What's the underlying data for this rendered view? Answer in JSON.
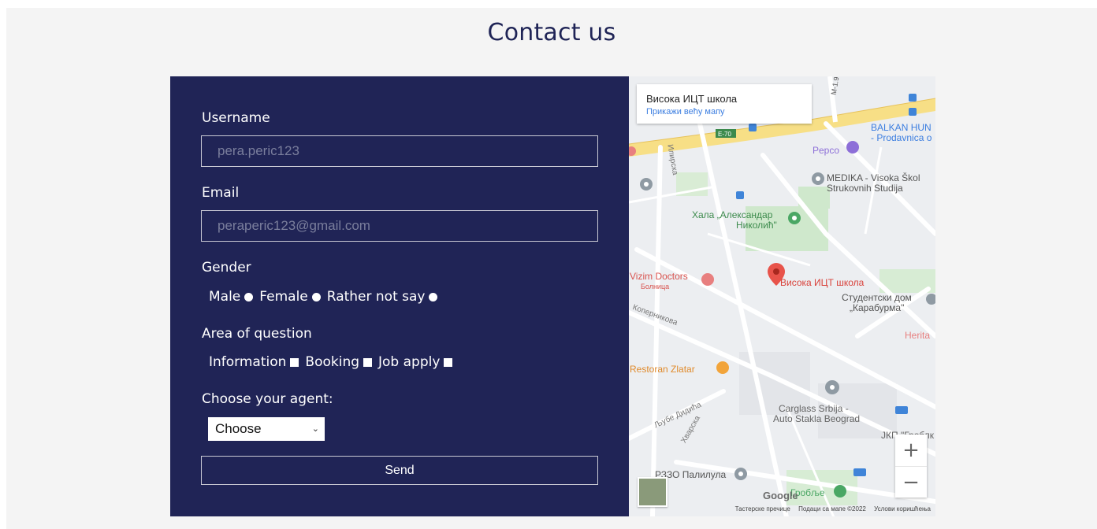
{
  "page": {
    "title": "Contact us"
  },
  "form": {
    "username_label": "Username",
    "username_placeholder": "pera.peric123",
    "email_label": "Email",
    "email_placeholder": "peraperic123@gmail.com",
    "gender_label": "Gender",
    "gender_options": [
      "Male",
      "Female",
      "Rather not say"
    ],
    "area_label": "Area of question",
    "area_options": [
      "Information",
      "Booking",
      "Job apply"
    ],
    "agent_label": "Choose your agent:",
    "agent_selected": "Choose",
    "send_label": "Send"
  },
  "map": {
    "card_name": "Висока ИЦТ школа",
    "card_link": "Прикажи већу мапу",
    "places": {
      "balkan": "BALKAN HUN",
      "prodavnica": "- Prodavnica o",
      "pepco": "Pepco",
      "medika1": "MEDIKA - Visoka Škol",
      "medika2": "Strukovnih Studija",
      "hala1": "Хала „Александар",
      "hala2": "Николић\"",
      "vizim1": "Vizim Doctors",
      "vizim2": "Болница",
      "visoka": "Висока ИЦТ школа",
      "student1": "Студентски дом",
      "student2": "„Карабурма\"",
      "herita": "Herita",
      "restoran": "Restoran Zlatar",
      "carglass1": "Carglass Srbija -",
      "carglass2": "Auto Stakla Beograd",
      "jkp": "ЈКП \"Гроблк",
      "rzzo": "РЗЗО Палилула",
      "groblje": "Гробље",
      "ilirska": "Илирска",
      "koperni": "Коперникова",
      "ljube": "Љубе Дидића",
      "hvarska": "Хварска",
      "e70": "E-70",
      "m19": "M-1.9"
    },
    "google": "Google",
    "attribution": [
      "Тастерске пречице",
      "Подаци са мапе ©2022",
      "Услови коришћења"
    ],
    "zoom_in": "+",
    "zoom_out": "−",
    "colors": {
      "road_yellow": "#f7df86",
      "park_green": "#cfe8cc",
      "pin_red": "#e8534a",
      "pin_green": "#4aa764",
      "pin_gray": "#8f9aa3",
      "transit_blue": "#3f84d8"
    }
  }
}
